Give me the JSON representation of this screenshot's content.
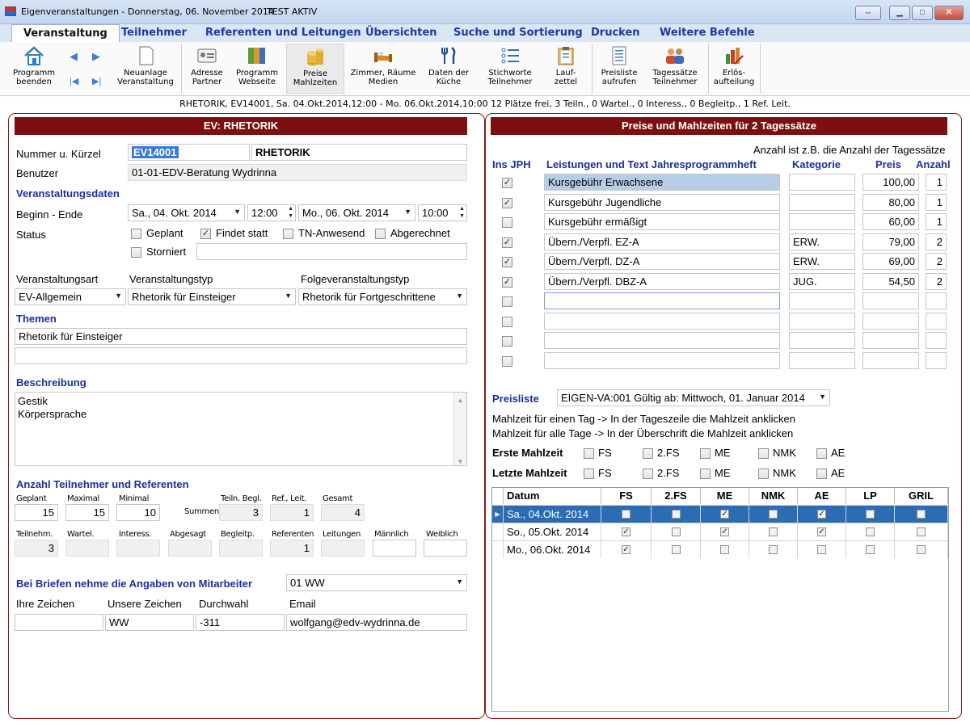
{
  "window": {
    "title": "Eigenveranstaltungen - Donnerstag, 06. November 2014",
    "status": "TEST AKTIV"
  },
  "menu": [
    "Veranstaltung",
    "Teilnehmer",
    "Referenten und Leitungen",
    "Übersichten",
    "Suche und Sortierung",
    "Drucken",
    "Weitere Befehle"
  ],
  "toolbar": {
    "programm_beenden": [
      "Programm",
      "beenden"
    ],
    "neuanlage": [
      "Neuanlage",
      "Veranstaltung"
    ],
    "adresse": [
      "Adresse",
      "Partner"
    ],
    "webseite": [
      "Programm",
      "Webseite"
    ],
    "preise": [
      "Preise",
      "Mahlzeiten"
    ],
    "zimmer": [
      "Zimmer, Räume",
      "Medien"
    ],
    "kueche": [
      "Daten der",
      "Küche"
    ],
    "stichworte": [
      "Stichworte",
      "Teilnehmer"
    ],
    "laufzettel": [
      "Lauf-",
      "zettel"
    ],
    "preisliste": [
      "Preisliste",
      "aufrufen"
    ],
    "tagessaetze": [
      "Tagessätze",
      "Teilnehmer"
    ],
    "erloes": [
      "Erlös-",
      "aufteilung"
    ]
  },
  "infobar": "RHETORIK, EV14001, Sa. 04.Okt.2014,12:00  -  Mo. 06.Okt.2014,10:00   12 Plätze frei, 3 Teiln., 0 Wartel., 0 Interess., 0 Begleitp., 1 Ref. Leit.",
  "left": {
    "header": "EV: RHETORIK",
    "nummer_label": "Nummer u. Kürzel",
    "nummer": "EV14001",
    "kuerzel": "RHETORIK",
    "benutzer_label": "Benutzer",
    "benutzer": "01-01-EDV-Beratung Wydrinna",
    "vdaten_title": "Veranstaltungsdaten",
    "beginn_label": "Beginn - Ende",
    "beginn_datum": "Sa., 04. Okt. 2014",
    "beginn_zeit": "12:00",
    "ende_datum": "Mo., 06. Okt. 2014",
    "ende_zeit": "10:00",
    "status_label": "Status",
    "status": {
      "geplant": "Geplant",
      "findet": "Findet statt",
      "tn": "TN-Anwesend",
      "abgerechnet": "Abgerechnet",
      "storniert": "Storniert"
    },
    "vart_label": "Veranstaltungsart",
    "vtyp_label": "Veranstaltungstyp",
    "ftyp_label": "Folgeveranstaltungstyp",
    "vart": "EV-Allgemein",
    "vtyp": "Rhetorik für Einsteiger",
    "ftyp": "Rhetorik für Fortgeschrittene",
    "themen_title": "Themen",
    "thema1": "Rhetorik für Einsteiger",
    "beschreibung_title": "Beschreibung",
    "beschreibung": [
      "Gestik",
      "Körpersprache"
    ],
    "anzahl_title": "Anzahl Teilnehmer und Referenten",
    "counts1": {
      "geplant_l": "Geplant",
      "maximal_l": "Maximal",
      "minimal_l": "Minimal",
      "summen_l": "Summen",
      "teiln_begl_l": "Teiln. Begl.",
      "ref_leit_l": "Ref., Leit.",
      "gesamt_l": "Gesamt",
      "geplant": "15",
      "maximal": "15",
      "minimal": "10",
      "teiln_begl": "3",
      "ref_leit": "1",
      "gesamt": "4"
    },
    "counts2": {
      "teilnehm_l": "Teilnehm.",
      "wartel_l": "Wartel.",
      "interess_l": "Interess.",
      "abgesagt_l": "Abgesagt",
      "begleitp_l": "Begleitp.",
      "referenten_l": "Referenten",
      "leitungen_l": "Leitungen",
      "maennlich_l": "Männlich",
      "weiblich_l": "Weiblich",
      "teilnehm": "3",
      "referenten": "1"
    },
    "briefe_label": "Bei Briefen nehme die Angaben von Mitarbeiter",
    "mitarbeiter": "01    WW",
    "ihre_label": "Ihre Zeichen",
    "unsere_label": "Unsere Zeichen",
    "durchwahl_label": "Durchwahl",
    "email_label": "Email",
    "unsere": "WW",
    "durchwahl": "-311",
    "email": "wolfgang@edv-wydrinna.de"
  },
  "right": {
    "header": "Preise und Mahlzeiten für 2 Tagessätze",
    "hint": "Anzahl ist z.B. die Anzahl der Tagessätze",
    "col_ins": "Ins JPH",
    "col_text": "Leistungen und Text Jahresprogrammheft",
    "col_kat": "Kategorie",
    "col_preis": "Preis",
    "col_anz": "Anzahl",
    "rows": [
      {
        "checked": true,
        "text": "Kursgebühr Erwachsene",
        "kat": "",
        "preis": "100,00",
        "anz": "1"
      },
      {
        "checked": true,
        "text": "Kursgebühr Jugendliche",
        "kat": "",
        "preis": "80,00",
        "anz": "1"
      },
      {
        "checked": false,
        "text": "Kursgebühr ermäßigt",
        "kat": "",
        "preis": "60,00",
        "anz": "1"
      },
      {
        "checked": true,
        "text": "Übern./Verpfl. EZ-A",
        "kat": "ERW.",
        "preis": "79,00",
        "anz": "2"
      },
      {
        "checked": true,
        "text": "Übern./Verpfl. DZ-A",
        "kat": "ERW.",
        "preis": "69,00",
        "anz": "2"
      },
      {
        "checked": true,
        "text": "Übern./Verpfl. DBZ-A",
        "kat": "JUG.",
        "preis": "54,50",
        "anz": "2"
      },
      {
        "checked": false,
        "text": "",
        "kat": "",
        "preis": "",
        "anz": ""
      },
      {
        "checked": false,
        "text": "",
        "kat": "",
        "preis": "",
        "anz": ""
      },
      {
        "checked": false,
        "text": "",
        "kat": "",
        "preis": "",
        "anz": ""
      },
      {
        "checked": false,
        "text": "",
        "kat": "",
        "preis": "",
        "anz": ""
      }
    ],
    "preisliste_label": "Preisliste",
    "preisliste": "EIGEN-VA:001 Gültig ab: Mittwoch, 01. Januar 2014",
    "hint_tag": "Mahlzeit für einen Tag ->  In der Tageszeile die Mahlzeit anklicken",
    "hint_alle": "Mahlzeit für alle Tage  ->  In der Überschrift die Mahlzeit anklicken",
    "erste_label": "Erste Mahlzeit",
    "letzte_label": "Letzte Mahlzeit",
    "meals": [
      "FS",
      "2.FS",
      "ME",
      "NMK",
      "AE"
    ],
    "grid_cols": [
      "Datum",
      "FS",
      "2.FS",
      "ME",
      "NMK",
      "AE",
      "LP",
      "GRIL"
    ],
    "grid_rows": [
      {
        "datum": "Sa., 04.Okt. 2014",
        "vals": [
          false,
          false,
          true,
          false,
          true,
          false,
          false
        ],
        "selected": true
      },
      {
        "datum": "So., 05.Okt. 2014",
        "vals": [
          true,
          false,
          true,
          false,
          true,
          false,
          false
        ],
        "selected": false
      },
      {
        "datum": "Mo., 06.Okt. 2014",
        "vals": [
          true,
          false,
          false,
          false,
          false,
          false,
          false
        ],
        "selected": false
      }
    ]
  },
  "colors": {
    "accent": "#7d0f0f",
    "section_blue": "#1a2fa0",
    "selection": "#2b6cb5"
  }
}
